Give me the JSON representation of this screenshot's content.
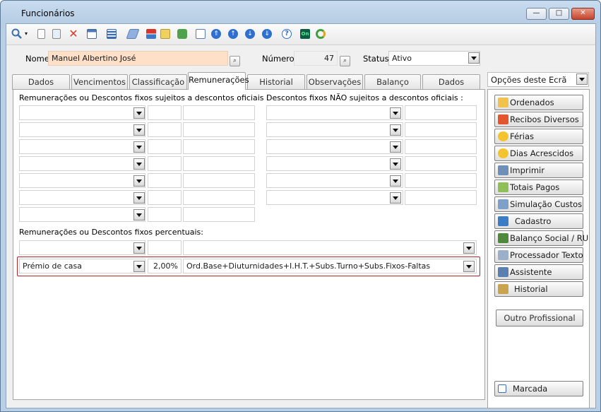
{
  "window": {
    "title": "Funcionários",
    "minimize": "—",
    "restore": "□",
    "close": "✕"
  },
  "toolbar": {
    "icons": [
      "search-icon",
      "new-document-icon",
      "copy-document-icon",
      "delete-icon",
      "properties-icon",
      "grid-icon",
      "eraser-icon",
      "org-chart-icon",
      "mail-icon",
      "refresh-icon",
      "preview-icon",
      "first-icon",
      "previous-icon",
      "next-icon",
      "last-icon",
      "help-icon",
      "toggle-on-icon",
      "sync-icon"
    ]
  },
  "header": {
    "name_label": "Nome",
    "name_value": "Manuel Albertino José",
    "number_label": "Número",
    "number_value": "47",
    "status_label": "Status",
    "status_value": "Ativo"
  },
  "tabs": [
    "Dados Principa",
    "Vencimentos",
    "Classificação",
    "Remunerações",
    "Historial",
    "Observações",
    "Balanço Social",
    "Dados Oficiais"
  ],
  "remuneracoes": {
    "fixed_subject_title": "Remunerações ou Descontos fixos sujeitos a descontos oficiais :",
    "fixed_not_subject_title": "Descontos fixos NÃO sujeitos a descontos oficiais :",
    "percentual_title": "Remunerações ou Descontos fixos percentuais:",
    "percent_row": {
      "item": "Prémio de casa",
      "percent": "2,00%",
      "base": "Ord.Base+Diuturnidades+I.H.T.+Subs.Turno+Subs.Fixos-Faltas"
    }
  },
  "options": {
    "label": "Opções deste Ecrã",
    "buttons": [
      {
        "label": "Ordenados",
        "icon": "folder-icon",
        "color": "#f2c24f"
      },
      {
        "label": "Recibos Diversos",
        "icon": "receipt-icon",
        "color": "#e4572e"
      },
      {
        "label": "Férias",
        "icon": "sunglasses-icon",
        "color": "#f4c430"
      },
      {
        "label": "Dias Acrescidos",
        "icon": "sunglasses-icon",
        "color": "#f4c430"
      },
      {
        "label": "Imprimir",
        "icon": "printer-icon",
        "color": "#6d8fb8"
      },
      {
        "label": "Totais Pagos",
        "icon": "report-icon",
        "color": "#8fbf58"
      },
      {
        "label": "Simulação Custos",
        "icon": "calculator-icon",
        "color": "#7da0c9"
      },
      {
        "label": "Cadastro",
        "icon": "palette-icon",
        "color": "#3b7dc4"
      },
      {
        "label": "Balanço Social / RU",
        "icon": "book-icon",
        "color": "#4f8a3c"
      },
      {
        "label": "Processador Texto",
        "icon": "notepad-icon",
        "color": "#9ab0c8"
      },
      {
        "label": "Assistente",
        "icon": "assistant-icon",
        "color": "#5b7fae"
      },
      {
        "label": "Historial",
        "icon": "tools-icon",
        "color": "#c9a34d"
      }
    ],
    "other_professional": "Outro Profissional",
    "marcada": "Marcada"
  }
}
